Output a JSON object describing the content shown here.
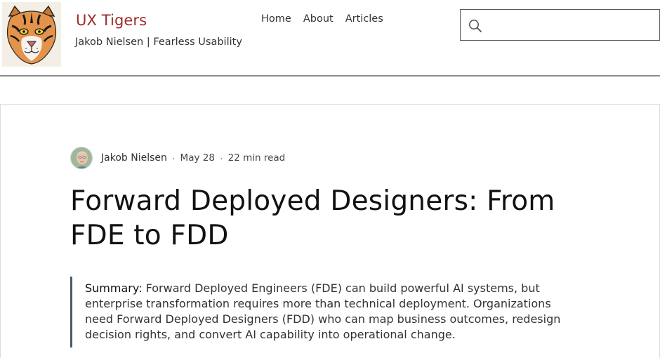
{
  "site": {
    "title": "UX Tigers",
    "tagline": "Jakob Nielsen | Fearless Usability"
  },
  "nav": {
    "items": [
      {
        "label": "Home"
      },
      {
        "label": "About"
      },
      {
        "label": "Articles"
      }
    ]
  },
  "search": {
    "value": "",
    "placeholder": ""
  },
  "post": {
    "author": "Jakob Nielsen",
    "separator": "·",
    "date": "May 28",
    "read_time": "22 min read",
    "title": "Forward Deployed Designers: From FDE to FDD",
    "summary_label": "Summary:",
    "summary_text": " Forward Deployed Engineers (FDE) can build powerful AI systems, but enterprise transformation requires more than technical deployment. Organizations need Forward Deployed Designers (FDD) who can map business outcomes, redesign decision rights, and convert AI capability into operational change."
  },
  "colors": {
    "brand": "#9e2a2b",
    "header_rule": "#8d8d8d",
    "quote_bar": "#4a5a6a"
  }
}
